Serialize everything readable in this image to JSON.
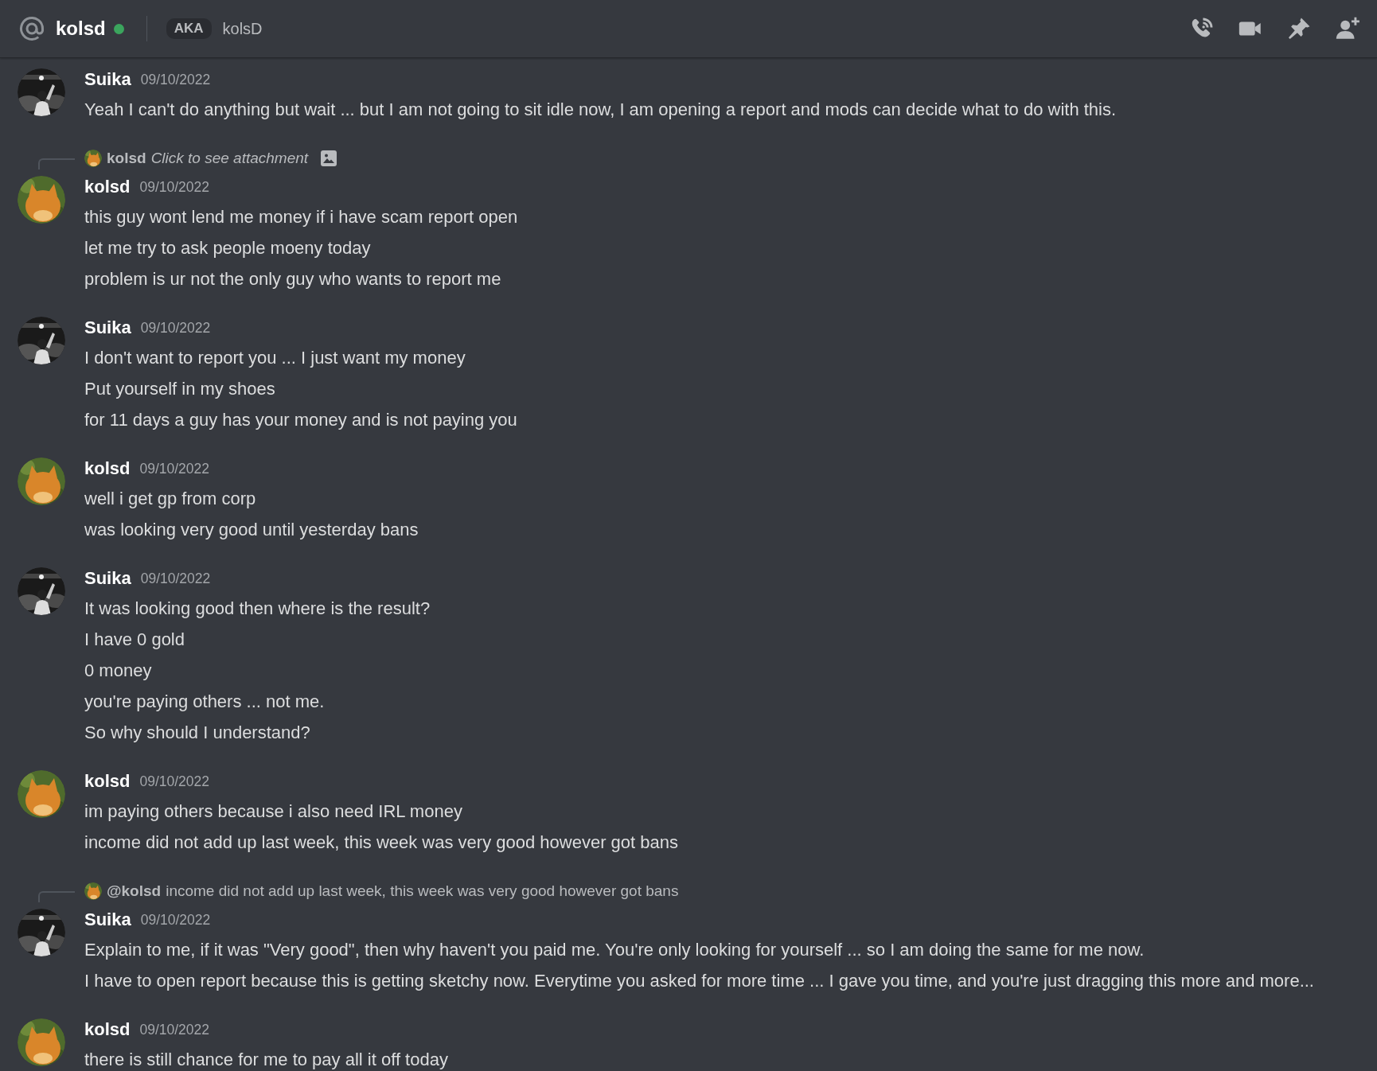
{
  "header": {
    "name": "kolsd",
    "online": true,
    "aka_label": "AKA",
    "aka_name": "kolsD"
  },
  "messages": [
    {
      "author": "Suika",
      "date": "09/10/2022",
      "avatar": {
        "kind": "picture",
        "color": "#1a1a1a"
      },
      "lines": [
        "Yeah I can't do anything but wait ... but I am not going to sit idle now, I am opening a report and mods can decide what to do with this."
      ]
    },
    {
      "author": "kolsd",
      "date": "09/10/2022",
      "avatar": {
        "kind": "picture",
        "color": "#d9862a"
      },
      "reply": {
        "kind": "attachment",
        "author": "kolsd",
        "text": "Click to see attachment"
      },
      "lines": [
        "this guy wont lend me money if i have scam report open",
        "let me try to ask people moeny today",
        "problem is ur not the only guy who wants to report me"
      ]
    },
    {
      "author": "Suika",
      "date": "09/10/2022",
      "avatar": {
        "kind": "picture",
        "color": "#1a1a1a"
      },
      "lines": [
        "I don't want to report you ... I just want my money",
        "Put yourself in my shoes",
        "for 11 days a guy has your money and is not paying you"
      ]
    },
    {
      "author": "kolsd",
      "date": "09/10/2022",
      "avatar": {
        "kind": "picture",
        "color": "#d9862a"
      },
      "lines": [
        "well i get gp from corp",
        "was looking very good until yesterday bans"
      ]
    },
    {
      "author": "Suika",
      "date": "09/10/2022",
      "avatar": {
        "kind": "picture",
        "color": "#1a1a1a"
      },
      "lines": [
        "It was looking good then where is the result?",
        "I have 0 gold",
        "0 money",
        "you're paying others ... not me.",
        "So why should I understand?"
      ]
    },
    {
      "author": "kolsd",
      "date": "09/10/2022",
      "avatar": {
        "kind": "picture",
        "color": "#d9862a"
      },
      "lines": [
        "im paying others because i also need IRL money",
        "income did not add up last week, this week was very good however got bans"
      ]
    },
    {
      "author": "Suika",
      "date": "09/10/2022",
      "avatar": {
        "kind": "picture",
        "color": "#1a1a1a"
      },
      "reply": {
        "kind": "text",
        "author": "@kolsd",
        "text": "income did not add up last week, this week was very good however got bans"
      },
      "lines": [
        "Explain to me, if it was \"Very good\", then why haven't you paid me. You're only looking for yourself ... so I am doing the same for me now.",
        "I have to open report because this is getting sketchy now. Everytime you asked for more time ... I gave you time, and you're just dragging this more and more..."
      ]
    },
    {
      "author": "kolsd",
      "date": "09/10/2022",
      "avatar": {
        "kind": "picture",
        "color": "#d9862a"
      },
      "lines": [
        "there is still chance for me to pay all it off today"
      ]
    }
  ]
}
